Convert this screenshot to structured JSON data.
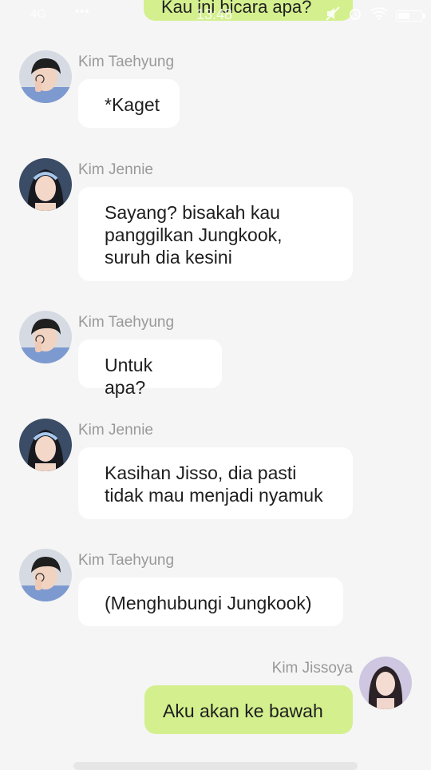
{
  "status_bar": {
    "signal": "4G",
    "dots": "•••",
    "time": "13:48"
  },
  "top_message": "Kau ini bicara apa?",
  "messages": [
    {
      "sender": "Kim Taehyung",
      "text": "*Kaget"
    },
    {
      "sender": "Kim Jennie",
      "lines": [
        "Sayang? bisakah kau",
        "panggilkan Jungkook,",
        "suruh dia kesini"
      ]
    },
    {
      "sender": "Kim Taehyung",
      "text": "Untuk apa?"
    },
    {
      "sender": "Kim Jennie",
      "lines": [
        "Kasihan Jisso, dia pasti",
        "tidak mau menjadi nyamuk"
      ]
    },
    {
      "sender": "Kim Taehyung",
      "text": "(Menghubungi Jungkook)"
    },
    {
      "sender": "Kim Jissoya",
      "text": "Aku akan ke bawah"
    }
  ],
  "colors": {
    "background": "#f5f5f5",
    "incoming_bubble": "#ffffff",
    "outgoing_bubble": "#d4f08e",
    "sender_name": "#999999"
  }
}
